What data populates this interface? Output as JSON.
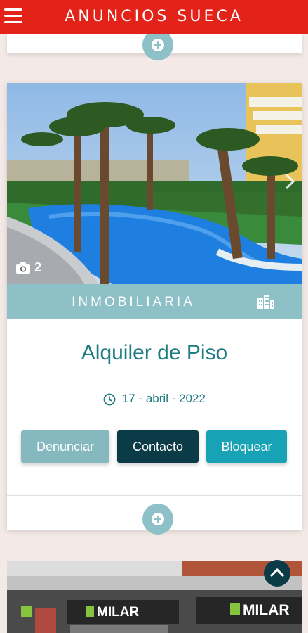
{
  "header": {
    "title": "ANUNCIOS SUECA"
  },
  "ad": {
    "photo_count": "2",
    "category": "INMOBILIARIA",
    "title": "Alquiler de Piso",
    "date": "17 - abril - 2022",
    "buttons": {
      "report": "Denunciar",
      "contact": "Contacto",
      "block": "Bloquear"
    }
  },
  "next_ad": {
    "sign_left": "MILAR",
    "sign_right": "MILAR"
  },
  "colors": {
    "header": "#e32219",
    "teal_light": "#8ec1c7",
    "teal_text": "#1f7c82",
    "dark_teal": "#0b3b47",
    "cyan": "#17a3b5"
  }
}
